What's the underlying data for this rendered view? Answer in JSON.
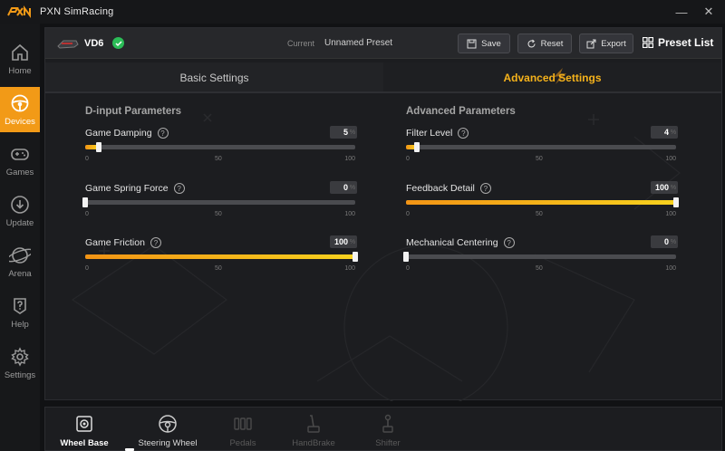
{
  "app": {
    "logo_text": "PXN",
    "title": "PXN SimRacing"
  },
  "window_controls": {
    "minimize": "—",
    "close": "✕"
  },
  "sidebar": {
    "items": [
      {
        "label": "Home",
        "icon": "home-icon",
        "active": false
      },
      {
        "label": "Devices",
        "icon": "steering-wheel-icon",
        "active": true
      },
      {
        "label": "Games",
        "icon": "gamepad-icon",
        "active": false
      },
      {
        "label": "Update",
        "icon": "download-icon",
        "active": false
      },
      {
        "label": "Arena",
        "icon": "globe-icon",
        "active": false
      },
      {
        "label": "Help",
        "icon": "help-icon",
        "active": false
      },
      {
        "label": "Settings",
        "icon": "gear-icon",
        "active": false
      }
    ]
  },
  "device": {
    "name": "VD6",
    "connected": true
  },
  "preset": {
    "current_label": "Current",
    "name": "Unnamed Preset"
  },
  "toolbar": {
    "save": "Save",
    "reset": "Reset",
    "export": "Export",
    "preset_list": "Preset List"
  },
  "tabs": {
    "basic": "Basic Settings",
    "advanced": "Advanced Settings",
    "active": "advanced"
  },
  "sections": {
    "left_title": "D-input Parameters",
    "right_title": "Advanced Parameters"
  },
  "params": {
    "left": [
      {
        "name": "Game Damping",
        "value": 5
      },
      {
        "name": "Game Spring Force",
        "value": 0
      },
      {
        "name": "Game Friction",
        "value": 100
      }
    ],
    "right": [
      {
        "name": "Filter Level",
        "value": 4
      },
      {
        "name": "Feedback Detail",
        "value": 100
      },
      {
        "name": "Mechanical Centering",
        "value": 0
      }
    ]
  },
  "scale": {
    "min": "0",
    "mid": "50",
    "max": "100",
    "unit": "%"
  },
  "bottom": {
    "items": [
      {
        "label": "Wheel Base",
        "state": "selected"
      },
      {
        "label": "Steering Wheel",
        "state": "available"
      },
      {
        "label": "Pedals",
        "state": "disabled"
      },
      {
        "label": "HandBrake",
        "state": "disabled"
      },
      {
        "label": "Shifter",
        "state": "disabled"
      }
    ]
  },
  "colors": {
    "accent": "#f29a17",
    "fill_start": "#f29415",
    "fill_end": "#f7d21e",
    "connected": "#2bbd57"
  }
}
